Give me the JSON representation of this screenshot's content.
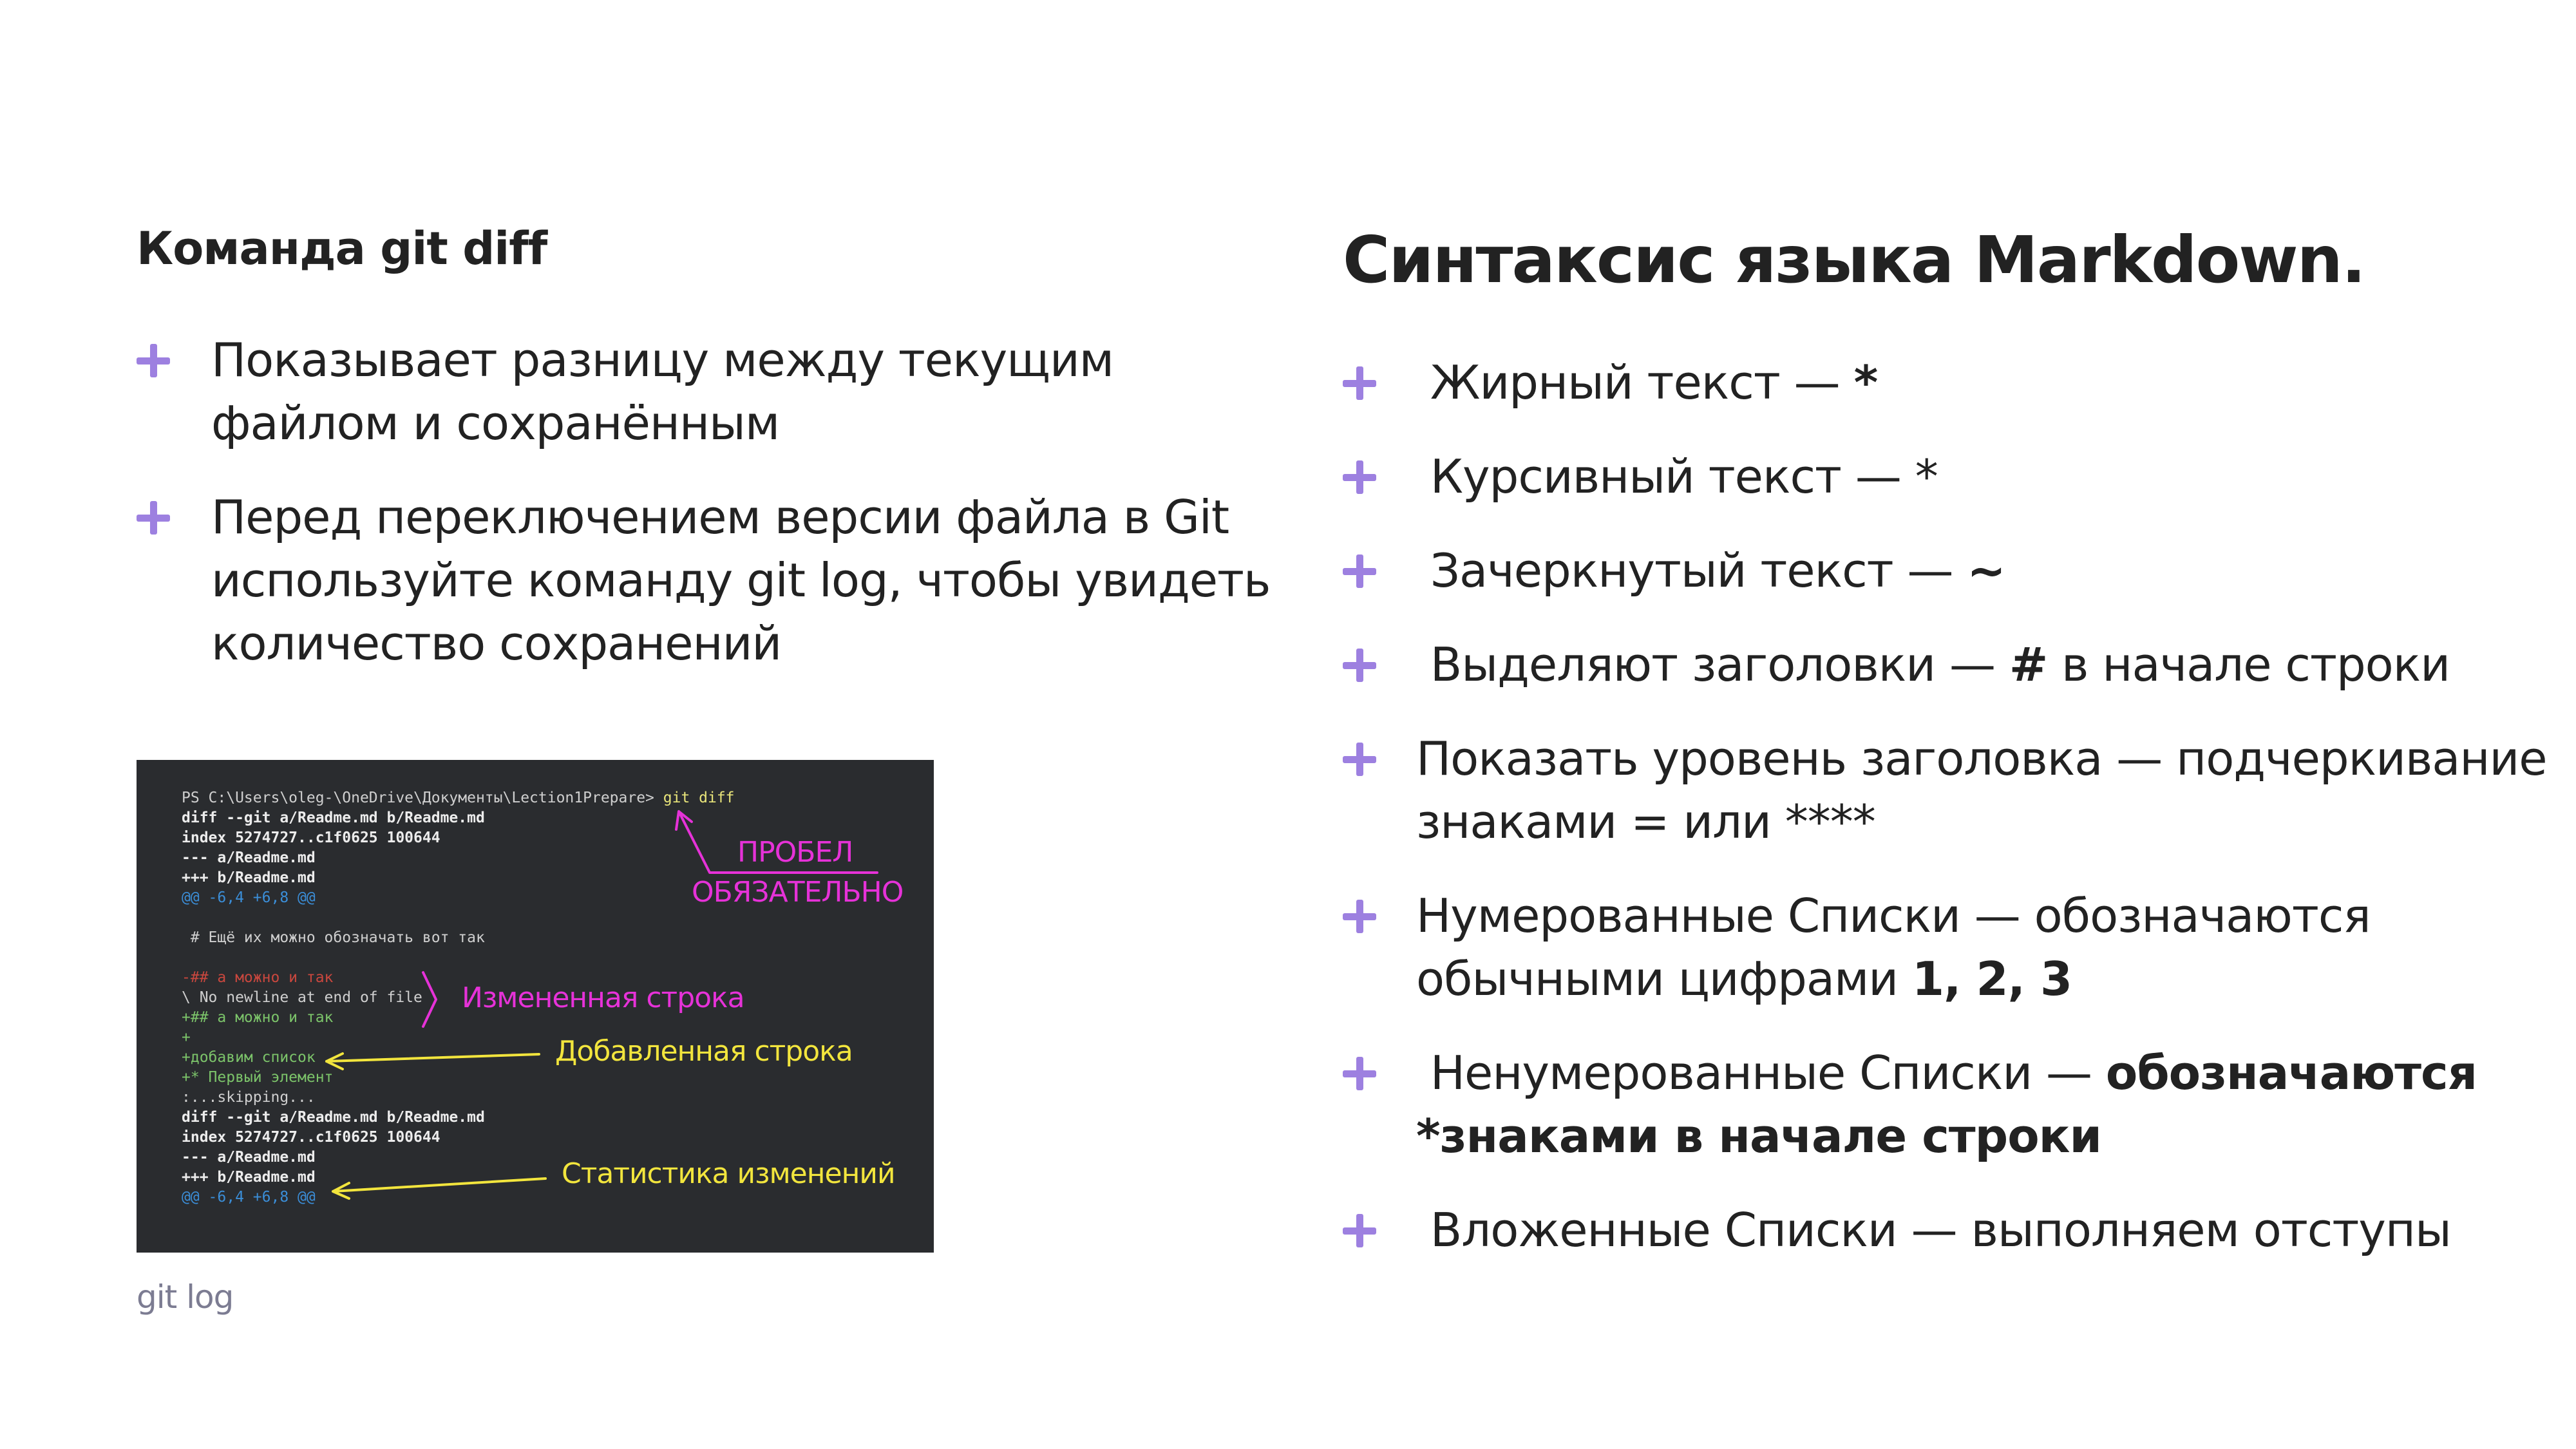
{
  "left": {
    "title": "Команда git diff",
    "bullets": [
      "Показывает разницу между текущим файлом и сохранённым",
      "Перед переключением версии файла в Git используйте команду git log, чтобы увидеть количество сохранений"
    ],
    "caption": "git log"
  },
  "right": {
    "title": "Синтаксис языка Markdown.",
    "bullets": [
      {
        "text": " Жирный текст — ",
        "bold": "*"
      },
      {
        "text": " Курсивный текст — *",
        "bold": ""
      },
      {
        "text": " Зачеркнутый текст — ",
        "bold": "~"
      },
      {
        "text": " Выделяют заголовки — ",
        "bold": "#",
        "tail": " в начале строки"
      },
      {
        "text": "Показать уровень заголовка — подчеркивание знаками = или ****",
        "bold": ""
      },
      {
        "text": "Нумерованные Списки — обозначаются обычными цифрами ",
        "bold": "1, 2, 3"
      },
      {
        "text": " Ненумерованные Списки — ",
        "bold": "обозначаются *знаками в начале строки"
      },
      {
        "text": " Вложенные Списки — выполняем отступы",
        "bold": ""
      }
    ]
  },
  "terminal": {
    "prompt": "PS C:\\Users\\oleg-\\OneDrive\\Документы\\Lection1Prepare> ",
    "command": "git diff",
    "lines": [
      "diff --git a/Readme.md b/Readme.md",
      "index 5274727..c1f0625 100644",
      "--- a/Readme.md",
      "+++ b/Readme.md",
      "@@ -6,4 +6,8 @@",
      "",
      " # Ещё их можно обозначать вот так",
      "",
      "-## а можно и так",
      "\\ No newline at end of file",
      "+## а можно и так",
      "+",
      "+добавим список",
      "+* Первый элемент",
      ":...skipping...",
      "diff --git a/Readme.md b/Readme.md",
      "index 5274727..c1f0625 100644",
      "--- a/Readme.md",
      "+++ b/Readme.md",
      "@@ -6,4 +6,8 @@"
    ],
    "annotations": {
      "space_1": "ПРОБЕЛ",
      "space_2": "ОБЯЗАТЕЛЬНО",
      "changed": "Измененная строка",
      "added": "Добавленная строка",
      "stats": "Статистика изменений"
    }
  },
  "colors": {
    "accent": "#9d80e0",
    "terminal_bg": "#2a2c2f",
    "annotation_pink": "#e632d8",
    "annotation_yellow": "#f2e53d"
  }
}
